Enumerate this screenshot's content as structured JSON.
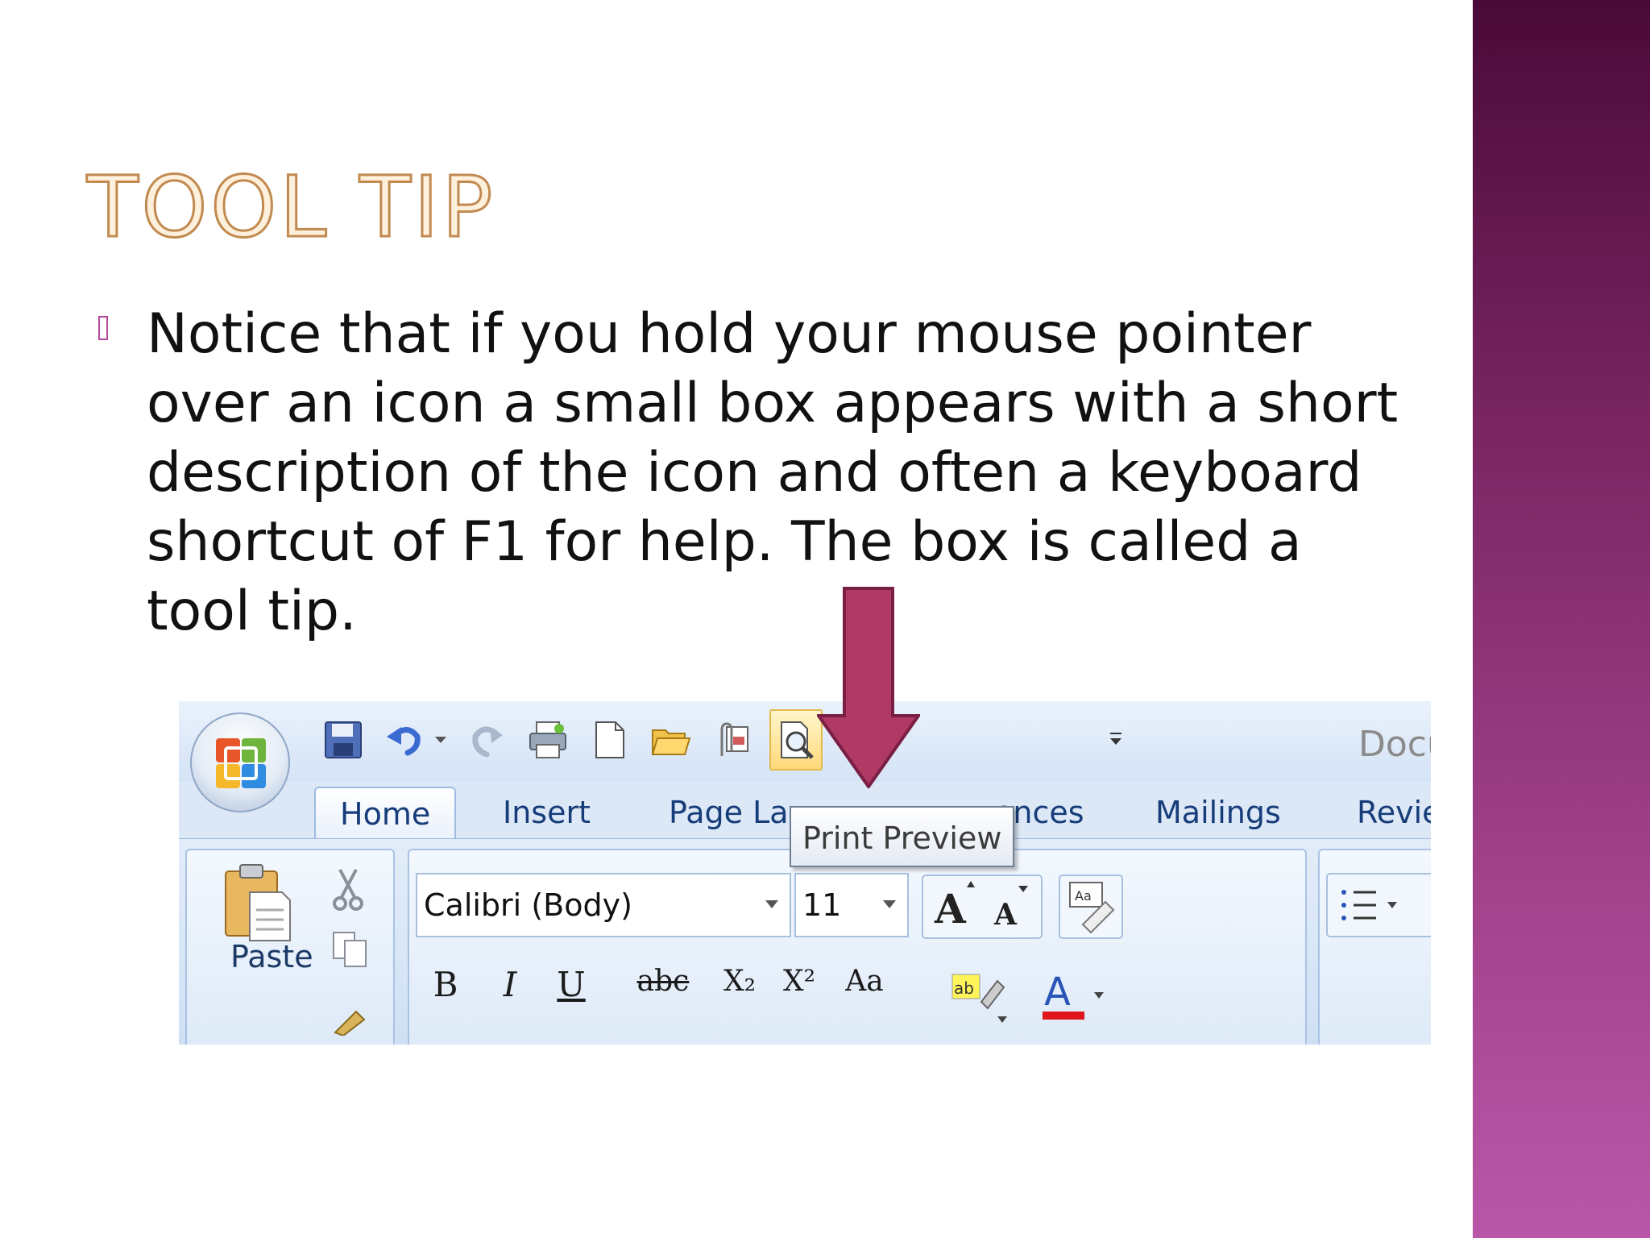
{
  "slide": {
    "title": "TOOL TIP",
    "body": "Notice that if you hold your mouse pointer over an icon a small box appears with a short description of the icon and often a keyboard shortcut of F1 for help. The box is called a tool tip."
  },
  "colors": {
    "title_fill": "#fdf0dc",
    "title_outline": "#c28a50",
    "arrow": "#b03a64",
    "sidebar_top": "#4a0a38",
    "sidebar_bottom": "#b957a8"
  },
  "screenshot": {
    "doc_title": "Docu",
    "tabs": [
      "Home",
      "Insert",
      "Page Lay",
      "ences",
      "Mailings",
      "Revie"
    ],
    "font_name": "Calibri (Body)",
    "font_size": "11",
    "paste_label": "Paste",
    "format_buttons": [
      "B",
      "I",
      "U",
      "abc",
      "X₂",
      "X²",
      "Aa"
    ],
    "tooltip": "Print Preview",
    "quick_access_icons": [
      "save-icon",
      "undo-icon",
      "redo-icon",
      "print-icon",
      "new-document-icon",
      "open-folder-icon",
      "attach-icon",
      "print-preview-icon",
      "customize-toolbar-icon"
    ]
  }
}
